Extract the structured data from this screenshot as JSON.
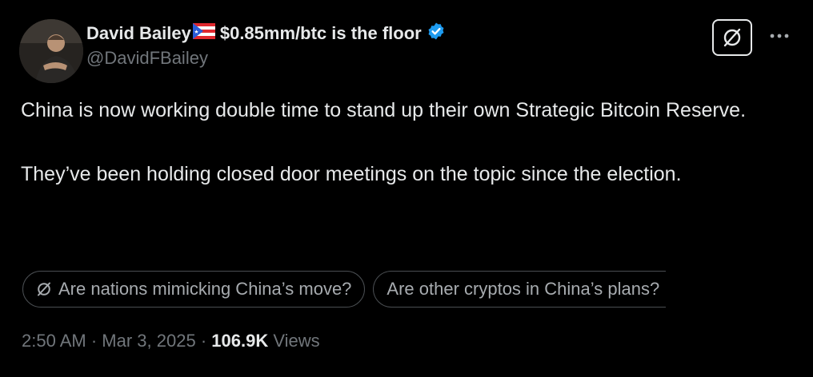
{
  "author": {
    "display_name": "David Bailey",
    "name_suffix": "$0.85mm/btc is the floor",
    "handle": "@DavidFBailey",
    "flag_icon": "puerto-rico-flag-icon",
    "verified_icon": "verified-badge-icon",
    "verified_color": "#1d9bf0"
  },
  "header_actions": {
    "grok_icon": "grok-icon",
    "more_icon": "more-options-icon"
  },
  "tweet": {
    "paragraph_1": "China is now working double time to stand up their own Strategic Bitcoin Reserve.",
    "paragraph_2": "They’ve been holding closed door meetings on the topic since the election."
  },
  "suggestions": [
    {
      "label": "Are nations mimicking China’s move?",
      "icon": "grok-icon"
    },
    {
      "label": "Are other cryptos in China’s plans?"
    }
  ],
  "meta": {
    "time": "2:50 AM",
    "separator": "·",
    "date": "Mar 3, 2025",
    "views_count": "106.9K",
    "views_label": "Views"
  },
  "colors": {
    "background": "#000000",
    "primary_text": "#e7e9ea",
    "secondary_text": "#71767b",
    "chip_border": "#4a4e52"
  }
}
